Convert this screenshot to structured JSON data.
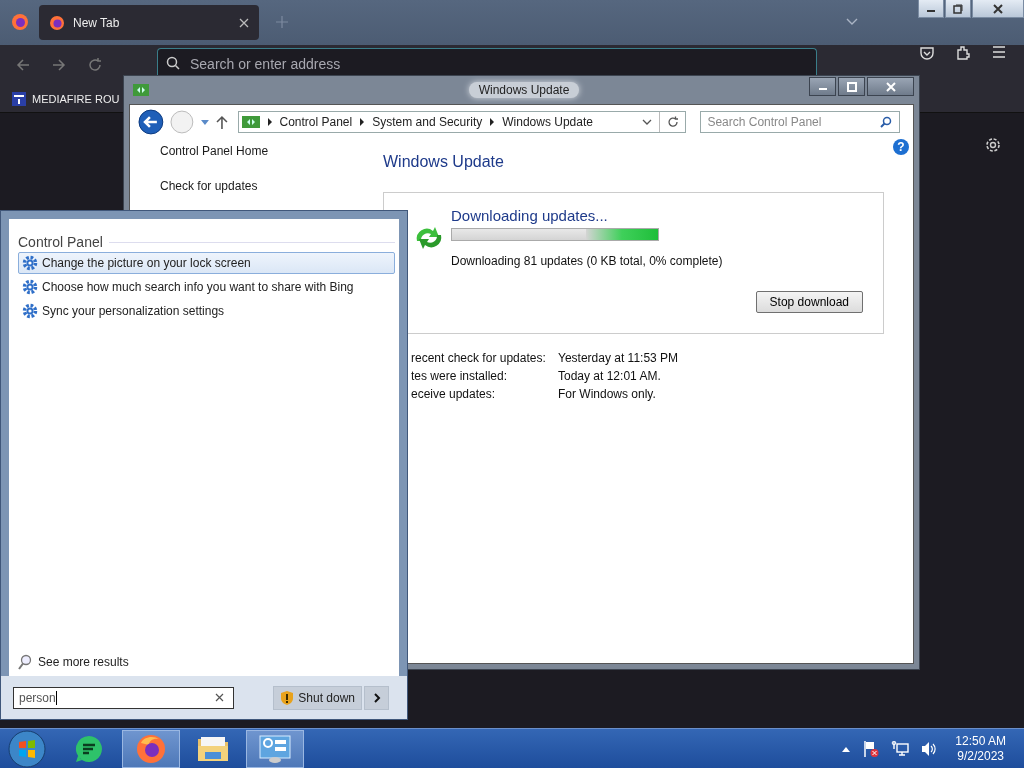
{
  "browser": {
    "tabs": [
      {
        "title": "New Tab",
        "selected": true
      }
    ],
    "address_bar": {
      "placeholder": "Search or enter address"
    },
    "bookmarks": [
      {
        "label": "MEDIAFIRE ROU"
      }
    ]
  },
  "control_panel": {
    "title": "Windows Update",
    "breadcrumb": [
      "Control Panel",
      "System and Security",
      "Windows Update"
    ],
    "search": {
      "placeholder": "Search Control Panel"
    },
    "help": "?",
    "nav_links": [
      "Control Panel Home",
      "Check for updates"
    ],
    "heading": "Windows Update",
    "status": {
      "title": "Downloading updates...",
      "level": 0.35,
      "detail": "Downloading 81 updates (0 KB total, 0% complete)",
      "button": "Stop download"
    },
    "info": [
      {
        "label": "recent check for updates:",
        "value": "Yesterday at 11:53 PM"
      },
      {
        "label": "tes were installed:",
        "value": "Today at 12:01 AM."
      },
      {
        "label": "eceive updates:",
        "value": "For Windows only."
      }
    ]
  },
  "start_menu": {
    "group": "Control Panel",
    "results": [
      {
        "label": "Change the picture on your lock screen",
        "selected": true
      },
      {
        "label": "Choose how much search info you want to share with Bing",
        "selected": false
      },
      {
        "label": "Sync your personalization settings",
        "selected": false
      }
    ],
    "more": "See more results",
    "search": {
      "value": "person"
    },
    "shutdown": "Shut down"
  },
  "taskbar": {
    "apps": [
      {
        "kind": "notes",
        "open": false
      },
      {
        "kind": "firefox",
        "open": true
      },
      {
        "kind": "explorer",
        "open": false
      },
      {
        "kind": "control-panel",
        "open": true
      }
    ],
    "clock": {
      "time": "12:50 AM",
      "date": "9/2/2023"
    }
  }
}
